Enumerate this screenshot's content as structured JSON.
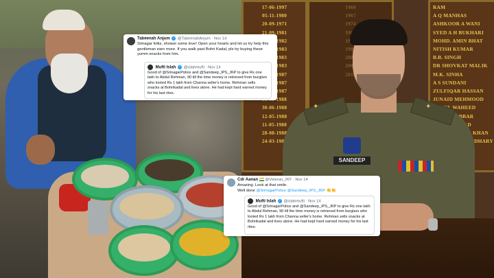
{
  "tweets": [
    {
      "author_name": "Tabeenah Anjum",
      "handle": "@TabeenahAnjum",
      "date": "Nov 14",
      "text": "Srinagar folks, shower some love! Open your hearts and let us try help this gentleman earn more. If you walk past Bohri Kadal, pls try buying these yumm snacks from him.",
      "quote": {
        "author_name": "Mufti Islah",
        "handle": "@islahmufti",
        "date": "Nov 14",
        "text": "Good of @SrinagarPolice and @Sandeep_IPS_JKP to give Rs one lakh to Abdul Rehman, 90 till the time money is retrieved from burglars who looted Rs 1 lakh from Channa seller's home. Rehman sells snacks at Bohrikadal and lives alone. He had kept hard earned money for his last rites."
      }
    },
    {
      "author_name": "Cdr Aanan",
      "handle": "@Veteran_007",
      "date": "Nov 14",
      "text": "Amazing. Look at that smile.",
      "text_line2": "Well done",
      "mentions": "@SrinagarPolice @Sandeep_IPS_JKP",
      "quote": {
        "author_name": "Mufti Islah",
        "handle": "@islahmufti",
        "date": "Nov 14",
        "text": "Good of @SrinagarPolice and @Sandeep_IPS_JKP to give Rs one lakh to Abdul Rehman, 90 till the time money is retrieved from burglars who looted Rs 1 lakh from Channa seller's home. Rehman sells snacks at Bohrikadal and lives alone. He had kept hard earned money for his last rites."
      }
    }
  ],
  "honor_board": {
    "dates": "17-06-1997\n05-11-1980\n20-09-1971\n21-09-1981\n14-08-1982\n08-05-1983\n19-11-1983\n05-12-1983\n03-10-1987\n10-09-1987\n04-12-1987\n16-11-1988\n30-06-1988\n12-05-1988\n11-05-1988\n28-08-1988\n24-03-1989",
    "mid": "1960\n1967\n1974\n1981\n1988\n1995\n2002\n2009\n2016",
    "names": "RAM\nA Q MANHAS\nASHKOOR A WANI\nSYED A H BUKHARI\nMOHD. AMIN BHAT\nNITISH KUMAR\nB.B. SINGH\nDR SHOVKAT MALIK\nM.K. SINHA\nA S SUNDANI\nZULFIQAR HASSAN\nJUNAID MEHMOOD\nABDUL WAHEED\nABDUL JABBAR\nALTAF AHMAD\nALTAF AHMAD KHAN\nSANDEEP CHAUDHARY"
  },
  "name_plate": "SANDEEP",
  "icons": {
    "verified": "verified-badge-icon",
    "flag": "india-flag-icon",
    "clap": "clapping-hands-icon"
  },
  "colors": {
    "link": "#1d9bf0",
    "verified": "#1d9bf0"
  }
}
